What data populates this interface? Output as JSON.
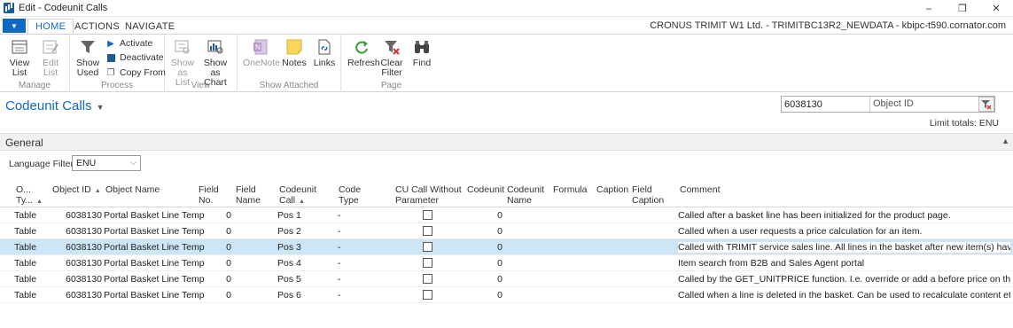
{
  "window": {
    "title": "Edit - Codeunit Calls",
    "controls": [
      "–",
      "❐",
      "✕"
    ]
  },
  "menu": {
    "app_button": "▼",
    "tabs": [
      "HOME",
      "ACTIONS",
      "NAVIGATE"
    ],
    "active_tab": "HOME",
    "company": "CRONUS TRIMIT W1 Ltd. - TRIMITBC13R2_NEWDATA - kbipc-t590.cornator.com"
  },
  "ribbon": {
    "manage": {
      "label": "Manage",
      "view_list": "View List",
      "edit_list": "Edit List"
    },
    "process": {
      "label": "Process",
      "show_used": "Show Used",
      "activate": "Activate",
      "deactivate": "Deactivate",
      "copy_from": "Copy From"
    },
    "view": {
      "label": "View",
      "show_as_list": "Show as List",
      "show_as_chart": "Show as Chart"
    },
    "show_attached": {
      "label": "Show Attached",
      "onenote": "OneNote",
      "notes": "Notes",
      "links": "Links"
    },
    "page": {
      "label": "Page",
      "refresh": "Refresh",
      "clear_filter": "Clear Filter",
      "find": "Find"
    }
  },
  "page": {
    "title": "Codeunit Calls",
    "filter_value": "6038130",
    "filter_field": "Object ID",
    "limit_totals": "Limit totals: ENU"
  },
  "general": {
    "label": "General",
    "language_filter_label": "Language Filter:",
    "language_filter_value": "ENU"
  },
  "grid": {
    "columns": {
      "object_type": [
        "O...",
        "Ty..."
      ],
      "object_id": "Object ID",
      "object_name": "Object Name",
      "field_no": [
        "Field",
        "No."
      ],
      "field_name": [
        "Field",
        "Name"
      ],
      "codeunit_call": [
        "Codeunit",
        "Call"
      ],
      "code_type": [
        "Code",
        "Type"
      ],
      "cu_call_without_param": [
        "CU Call Without",
        "Parameter"
      ],
      "codeunit": "Codeunit",
      "codeunit_name": [
        "Codeunit",
        "Name"
      ],
      "formula": "Formula",
      "caption": "Caption",
      "field_caption": [
        "Field",
        "Caption"
      ],
      "comment": "Comment"
    },
    "rows": [
      {
        "type": "Table",
        "id": "6038130",
        "name": "Portal Basket Line Temp",
        "field_no": "0",
        "call": "Pos 1",
        "code_type": "-",
        "codeunit": "0",
        "comment": "Called after a basket line has been initialized for the product page.",
        "selected": false
      },
      {
        "type": "Table",
        "id": "6038130",
        "name": "Portal Basket Line Temp",
        "field_no": "0",
        "call": "Pos 2",
        "code_type": "-",
        "codeunit": "0",
        "comment": "Called when a user requests a price calculation for an item.",
        "selected": false
      },
      {
        "type": "Table",
        "id": "6038130",
        "name": "Portal Basket Line Temp",
        "field_no": "0",
        "call": "Pos 3",
        "code_type": "-",
        "codeunit": "0",
        "comment": "Called with TRIMIT service sales line. All lines in the basket after new item(s) have been added o",
        "selected": true
      },
      {
        "type": "Table",
        "id": "6038130",
        "name": "Portal Basket Line Temp",
        "field_no": "0",
        "call": "Pos 4",
        "code_type": "-",
        "codeunit": "0",
        "comment": "Item search from B2B and Sales Agent portal",
        "selected": false
      },
      {
        "type": "Table",
        "id": "6038130",
        "name": "Portal Basket Line Temp",
        "field_no": "0",
        "call": "Pos 5",
        "code_type": "-",
        "codeunit": "0",
        "comment": "Called by the GET_UNITPRICE function. I.e. override or add a before price on the item overview",
        "selected": false
      },
      {
        "type": "Table",
        "id": "6038130",
        "name": "Portal Basket Line Temp",
        "field_no": "0",
        "call": "Pos 6",
        "code_type": "-",
        "codeunit": "0",
        "comment": "Called when a line is deleted in the basket. Can be used to recalculate content etc.",
        "selected": false
      }
    ]
  },
  "colors": {
    "accent": "#1068c5",
    "selected_row": "#cde6f7"
  }
}
